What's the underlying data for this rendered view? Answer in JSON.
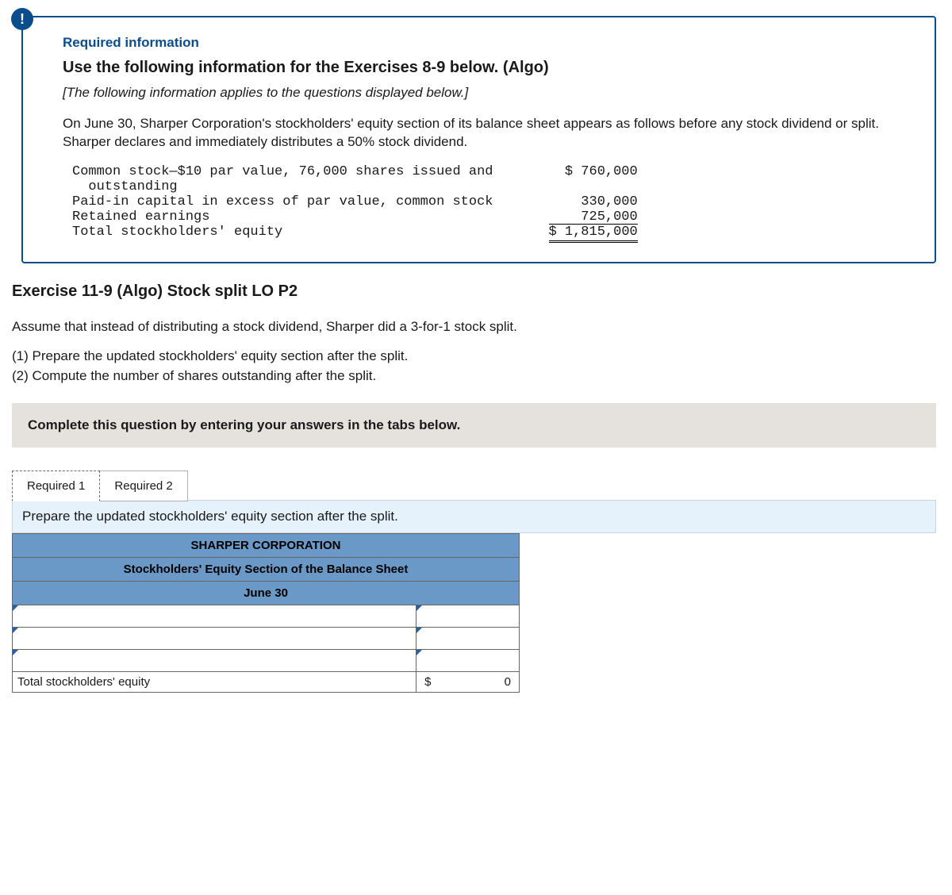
{
  "info": {
    "icon_glyph": "!",
    "required_label": "Required information",
    "heading": "Use the following information for the Exercises 8-9 below. (Algo)",
    "applies_note": "[The following information applies to the questions displayed below.]",
    "paragraph": "On June 30, Sharper Corporation's stockholders' equity section of its balance sheet appears as follows before any stock dividend or split. Sharper declares and immediately distributes a 50% stock dividend.",
    "equity": {
      "rows": [
        {
          "label": "Common stock—$10 par value, 76,000 shares issued and\n  outstanding",
          "value": "$ 760,000"
        },
        {
          "label": "Paid-in capital in excess of par value, common stock",
          "value": "330,000"
        },
        {
          "label": "Retained earnings",
          "value": "725,000"
        }
      ],
      "total_label": "Total stockholders' equity",
      "total_value": "$ 1,815,000"
    }
  },
  "exercise": {
    "title": "Exercise 11-9 (Algo) Stock split LO P2",
    "assume": "Assume that instead of distributing a stock dividend, Sharper did a 3-for-1 stock split.",
    "req1": "(1) Prepare the updated stockholders' equity section after the split.",
    "req2": "(2) Compute the number of shares outstanding after the split.",
    "instruction": "Complete this question by entering your answers in the tabs below.",
    "tabs": {
      "t1": "Required 1",
      "t2": "Required 2"
    },
    "panel_text": "Prepare the updated stockholders' equity section after the split.",
    "table": {
      "h1": "SHARPER CORPORATION",
      "h2": "Stockholders' Equity Section of the Balance Sheet",
      "h3": "June 30",
      "total_label": "Total stockholders' equity",
      "total_currency": "$",
      "total_value": "0"
    }
  }
}
